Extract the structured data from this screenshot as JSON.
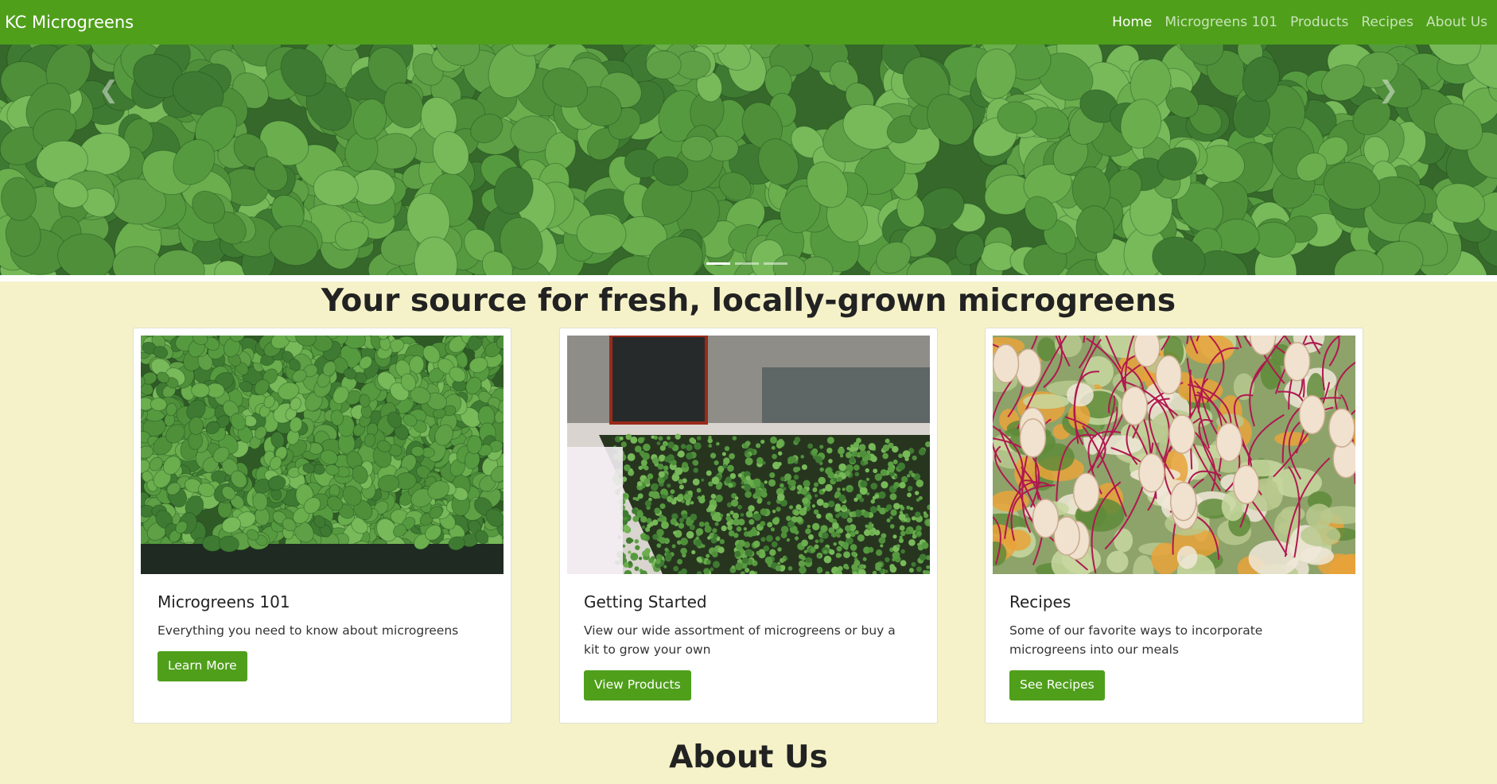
{
  "navbar": {
    "brand": "KC Microgreens",
    "links": [
      {
        "label": "Home",
        "active": true
      },
      {
        "label": "Microgreens 101",
        "active": false
      },
      {
        "label": "Products",
        "active": false
      },
      {
        "label": "Recipes",
        "active": false
      },
      {
        "label": "About Us",
        "active": false
      }
    ]
  },
  "carousel": {
    "prev_icon": "chevron-left-icon",
    "next_icon": "chevron-right-icon",
    "slide_count": 3,
    "active_slide": 1
  },
  "tagline": "Your source for fresh, locally-grown microgreens",
  "cards": [
    {
      "title": "Microgreens 101",
      "text": "Everything you need to know about microgreens",
      "button": "Learn More"
    },
    {
      "title": "Getting Started",
      "text": "View our wide assortment of microgreens or buy a kit to grow your own",
      "button": "View Products"
    },
    {
      "title": "Recipes",
      "text": "Some of our favorite ways to incorporate microgreens into our meals",
      "button": "See Recipes"
    }
  ],
  "about_heading": "About Us",
  "colors": {
    "nav_green": "#4f9f1b",
    "page_bg": "#f5f2c9",
    "button_green": "#4f9f1b"
  }
}
